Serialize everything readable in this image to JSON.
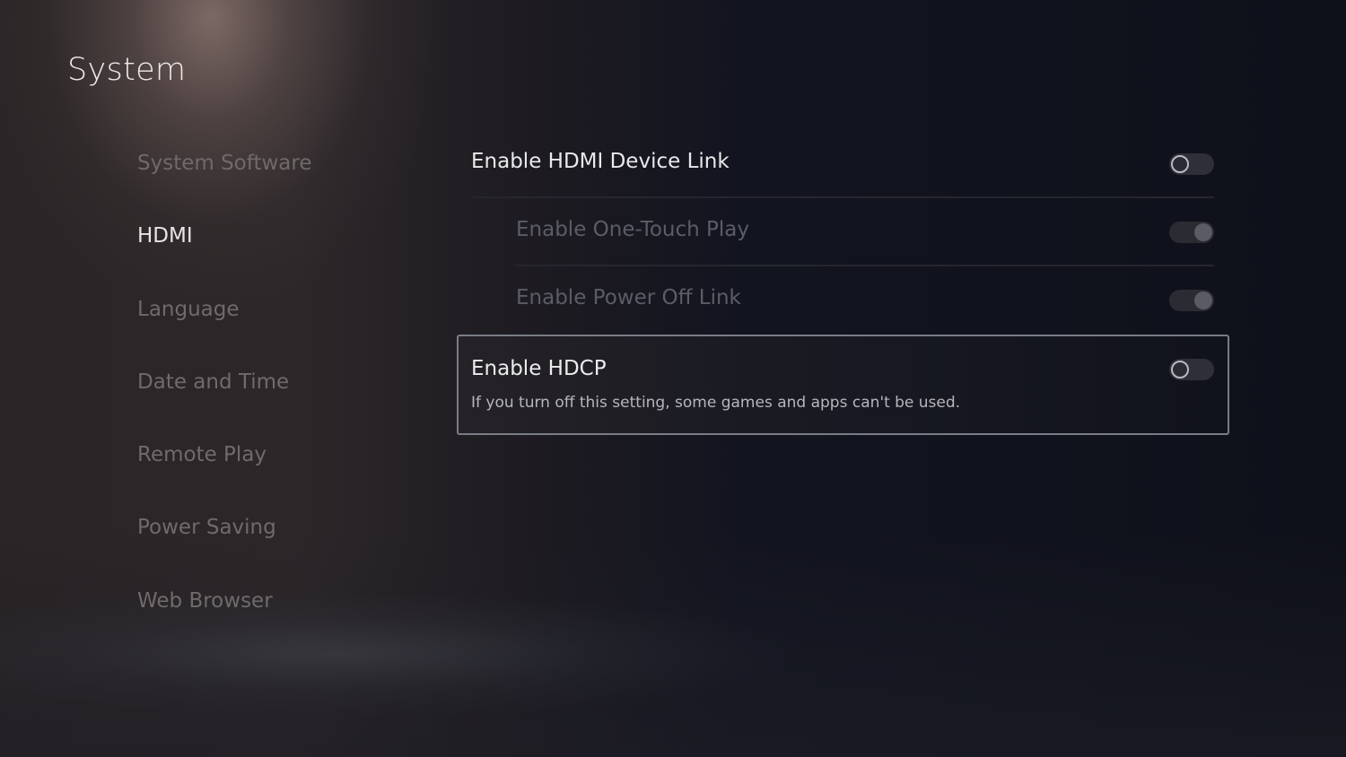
{
  "header": {
    "title": "System"
  },
  "sidebar": {
    "active_index": 1,
    "items": [
      {
        "label": "System Software"
      },
      {
        "label": "HDMI"
      },
      {
        "label": "Language"
      },
      {
        "label": "Date and Time"
      },
      {
        "label": "Remote Play"
      },
      {
        "label": "Power Saving"
      },
      {
        "label": "Web Browser"
      }
    ]
  },
  "settings": {
    "hdmi_device_link": {
      "label": "Enable HDMI Device Link",
      "state": "off"
    },
    "one_touch_play": {
      "label": "Enable One-Touch Play",
      "state": "on",
      "enabled": false
    },
    "power_off_link": {
      "label": "Enable Power Off Link",
      "state": "on",
      "enabled": false
    },
    "hdcp": {
      "label": "Enable HDCP",
      "description": "If you turn off this setting, some games and apps can't be used.",
      "state": "off",
      "focused": true
    }
  }
}
